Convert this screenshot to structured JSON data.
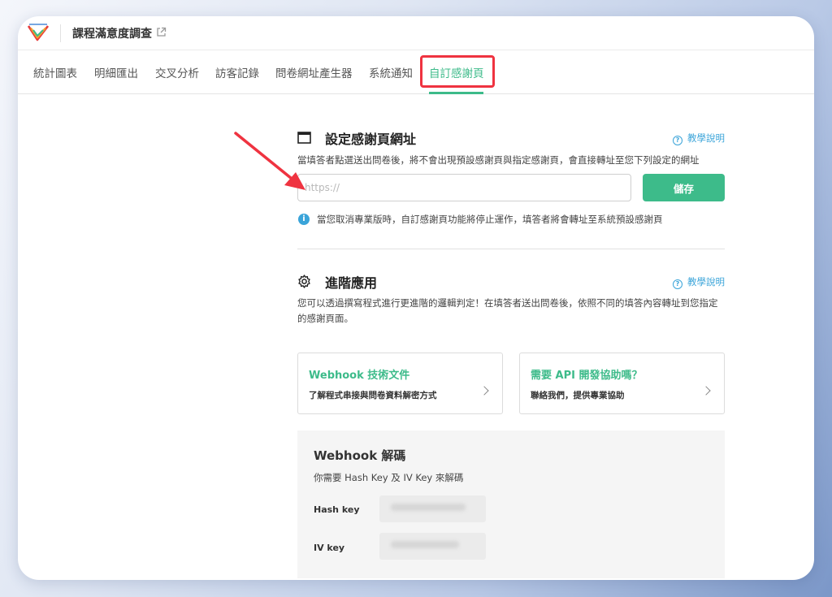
{
  "app": {
    "title": "課程滿意度調查",
    "logo": "survey-logo",
    "colors": {
      "accent": "#3dbb8a",
      "link": "#3aa4d9",
      "highlight": "#ef3340"
    }
  },
  "tabs": [
    {
      "label": "統計圖表"
    },
    {
      "label": "明細匯出"
    },
    {
      "label": "交叉分析"
    },
    {
      "label": "訪客記錄"
    },
    {
      "label": "問卷網址產生器"
    },
    {
      "label": "系統通知"
    },
    {
      "label": "自訂感謝頁",
      "active": true
    }
  ],
  "thankyou": {
    "title": "設定感謝頁網址",
    "help": "教學說明",
    "description": "當填答者點選送出問卷後，將不會出現預設感謝頁與指定感謝頁，會直接轉址至您下列設定的網址",
    "url_placeholder": "https://",
    "url_value": "",
    "save": "儲存",
    "notice": "當您取消專業版時，自訂感謝頁功能將停止運作，填答者將會轉址至系統預設感謝頁"
  },
  "advanced": {
    "title": "進階應用",
    "help": "教學說明",
    "description": "您可以透過撰寫程式進行更進階的邏輯判定！在填答者送出問卷後，依照不同的填答內容轉址到您指定的感謝頁面。",
    "cards": [
      {
        "title": "Webhook 技術文件",
        "desc": "了解程式串接與問卷資料解密方式"
      },
      {
        "title": "需要 API 開發協助嗎？",
        "desc": "聯絡我們，提供專業協助"
      }
    ]
  },
  "decode": {
    "title": "Webhook 解碼",
    "subtitle": "你需要 Hash Key 及 IV Key 來解碼",
    "hash_label": "Hash key",
    "iv_label": "IV key"
  }
}
